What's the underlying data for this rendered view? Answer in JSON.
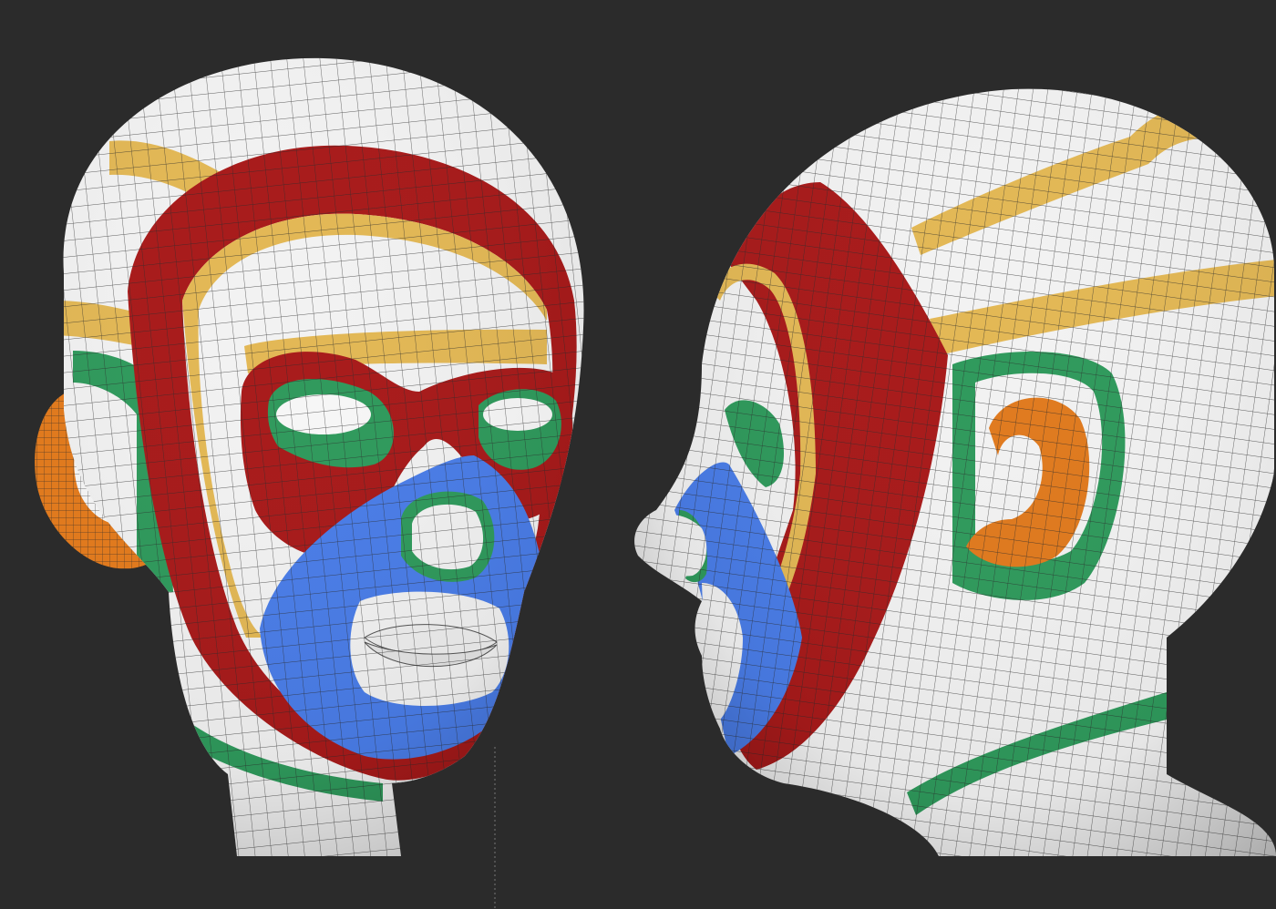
{
  "scene": {
    "background_color": "#2b2b2b",
    "mesh_colors": {
      "base": "#f2f2f2",
      "wire": "#2a2a2a",
      "red": "#a81a1a",
      "yellow": "#e3b855",
      "green": "#2f9a5c",
      "blue": "#4a7de8",
      "orange": "#e07a1e"
    },
    "views": [
      {
        "name": "front-three-quarter-view"
      },
      {
        "name": "side-profile-view"
      }
    ]
  }
}
